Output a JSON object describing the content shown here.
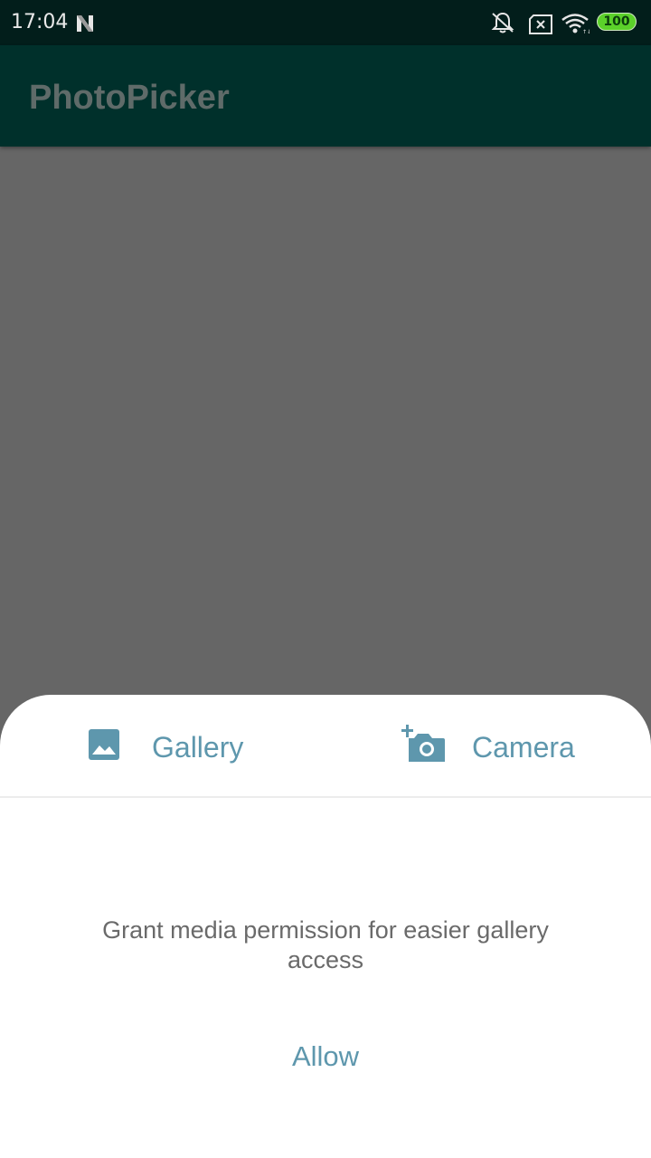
{
  "status_bar": {
    "time": "17:04",
    "battery_level": "100",
    "icons": [
      "n-notification-icon",
      "bell-muted-icon",
      "sim-x-icon",
      "wifi-icon",
      "battery-icon"
    ]
  },
  "app_bar": {
    "title": "PhotoPicker"
  },
  "sheet": {
    "tabs": [
      {
        "label": "Gallery",
        "icon": "image-icon"
      },
      {
        "label": "Camera",
        "icon": "add-camera-icon"
      }
    ],
    "permission_message": "Grant media permission for easier gallery access",
    "allow_label": "Allow"
  },
  "colors": {
    "status_bar_bg": "#021e1b",
    "app_bar_bg": "#00302b",
    "scrim_bg": "#666666",
    "accent": "#5e97ad",
    "message_text": "#6a6a6a"
  }
}
